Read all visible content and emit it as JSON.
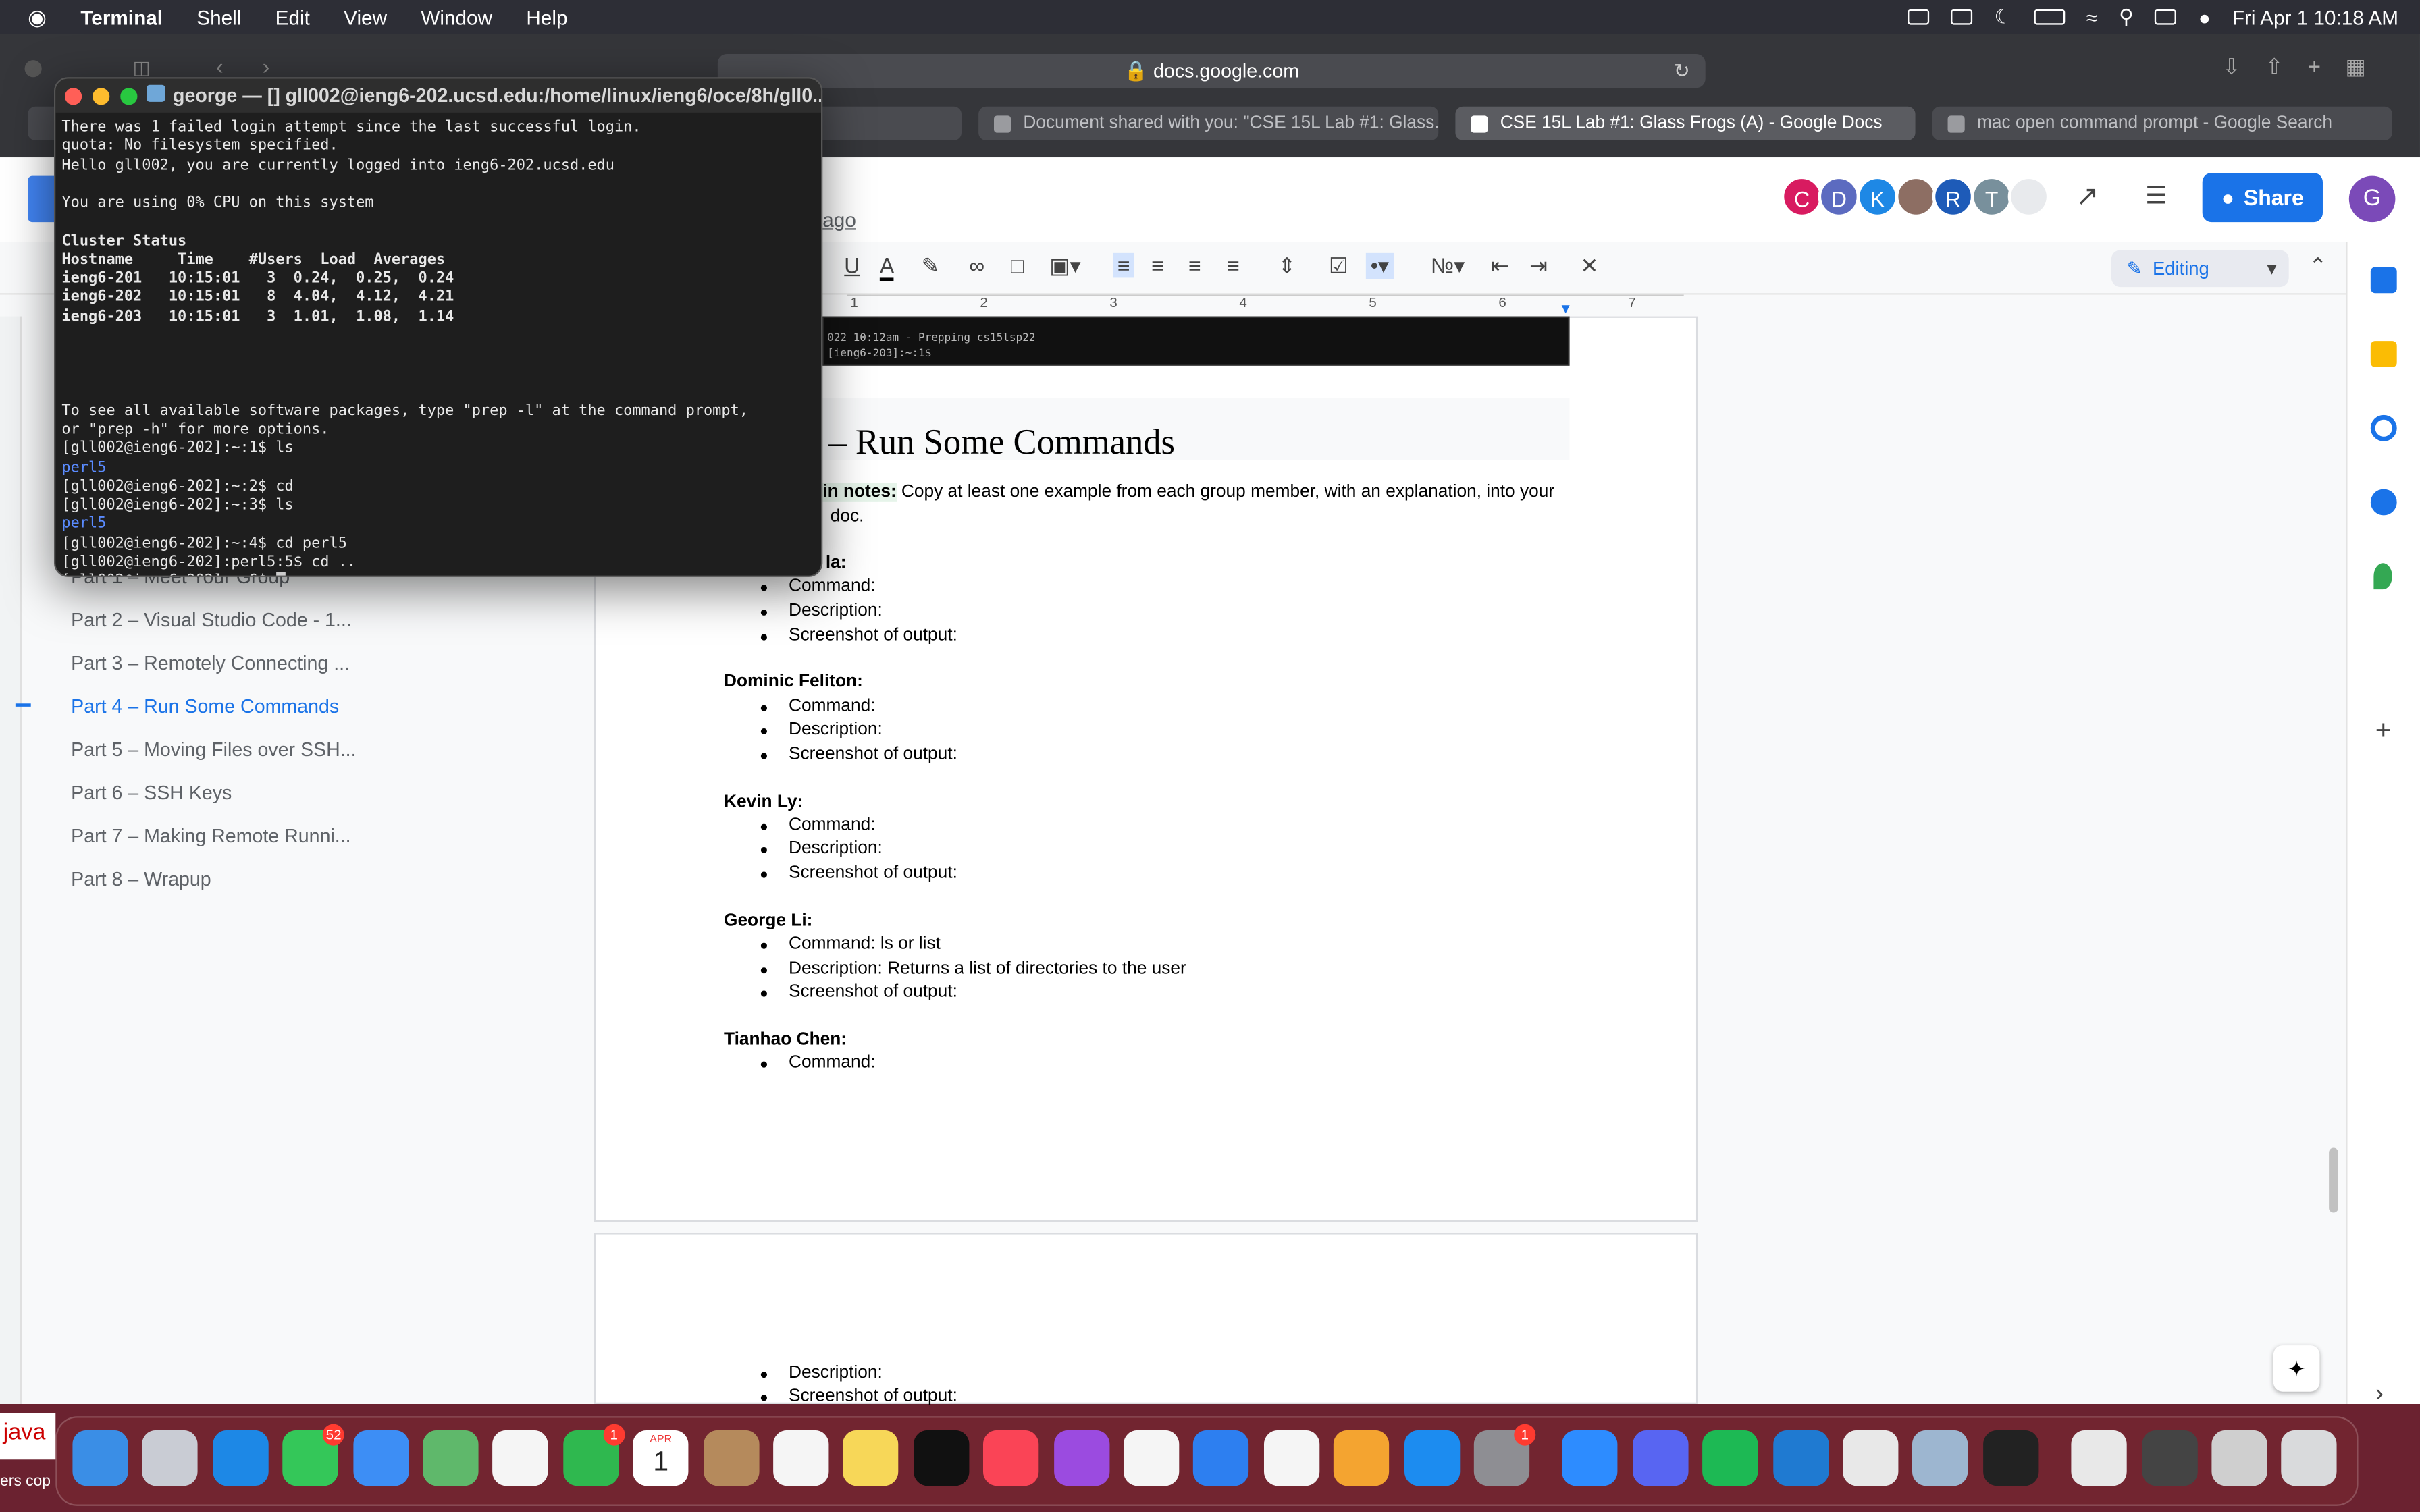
{
  "menubar": {
    "app": "Terminal",
    "items": [
      "Shell",
      "Edit",
      "View",
      "Window",
      "Help"
    ],
    "clock": "Fri Apr 1  10:18 AM"
  },
  "browser": {
    "url": "docs.google.com",
    "tabs": [
      {
        "label": "Document shared with you: \"CSE 15L Lab #1: Glass..."
      },
      {
        "label": "CSE 15L Lab #1: Glass Frogs (A) - Google Docs"
      },
      {
        "label": "mac open command prompt - Google Search"
      }
    ]
  },
  "docs": {
    "last_edit": "ago",
    "share_label": "Share",
    "editing_label": "Editing",
    "avatars": [
      {
        "letter": "C",
        "color": "#d81b60"
      },
      {
        "letter": "D",
        "color": "#5c6bc0"
      },
      {
        "letter": "K",
        "color": "#1e88e5"
      },
      {
        "letter": "",
        "color": "#8d6e63"
      },
      {
        "letter": "R",
        "color": "#1e5bb8"
      },
      {
        "letter": "T",
        "color": "#78909c"
      },
      {
        "letter": "",
        "color": "#e8eaed"
      }
    ],
    "user_avatar": "G",
    "ruler_marks": [
      "1",
      "2",
      "3",
      "4",
      "5",
      "6",
      "7"
    ],
    "outline": [
      {
        "label": "Part 1 – Meet Your Group"
      },
      {
        "label": "Part 2 – Visual Studio Code - 1..."
      },
      {
        "label": "Part 3 – Remotely Connecting ..."
      },
      {
        "label": "Part 4 – Run Some Commands"
      },
      {
        "label": "Part 5 – Moving Files over SSH..."
      },
      {
        "label": "Part 6 – SSH Keys"
      },
      {
        "label": "Part 7 – Making Remote Runni..."
      },
      {
        "label": "Part 8 – Wrapup"
      }
    ],
    "screenshot_strip": [
      "022 10:12am - Prepping cs15lsp22",
      "[ieng6-203]:~:1$"
    ],
    "heading": "– Run Some Commands",
    "note_label": "in notes:",
    "note_text": "Copy at least one example from each group member, with an explanation, into your",
    "note_text2": "doc.",
    "members": [
      {
        "name": "la:",
        "command": "Command:",
        "description": "Description:",
        "screenshot": "Screenshot of output:"
      },
      {
        "name": "Dominic Feliton:",
        "command": "Command:",
        "description": "Description:",
        "screenshot": "Screenshot of output:"
      },
      {
        "name": "Kevin Ly:",
        "command": "Command:",
        "description": "Description:",
        "screenshot": "Screenshot of output:"
      },
      {
        "name": "George Li:",
        "command": "Command: ls or list",
        "description": "Description: Returns a list of directories to the user",
        "screenshot": "Screenshot of output:"
      },
      {
        "name": "Tianhao Chen:",
        "command": "Command:"
      }
    ],
    "page2": {
      "description": "Description:",
      "screenshot": "Screenshot of output:"
    }
  },
  "terminal": {
    "title": "george — []  gll002@ieng6-202.ucsd.edu:/home/linux/ieng6/oce/8h/gll0...",
    "lines": [
      {
        "text": "There was 1 failed login attempt since the last successful login.",
        "style": ""
      },
      {
        "text": "quota: No filesystem specified.",
        "style": ""
      },
      {
        "text": "Hello gll002, you are currently logged into ieng6-202.ucsd.edu",
        "style": ""
      },
      {
        "text": "",
        "style": ""
      },
      {
        "text": "You are using 0% CPU on this system",
        "style": ""
      },
      {
        "text": "",
        "style": ""
      },
      {
        "text": "Cluster Status",
        "style": "b"
      },
      {
        "text": "Hostname     Time    #Users  Load  Averages",
        "style": "b"
      },
      {
        "text": "ieng6-201   10:15:01   3  0.24,  0.25,  0.24",
        "style": "b"
      },
      {
        "text": "ieng6-202   10:15:01   8  4.04,  4.12,  4.21",
        "style": "b"
      },
      {
        "text": "ieng6-203   10:15:01   3  1.01,  1.08,  1.14",
        "style": "b"
      },
      {
        "text": "",
        "style": ""
      },
      {
        "text": "",
        "style": ""
      },
      {
        "text": "",
        "style": ""
      },
      {
        "text": "",
        "style": ""
      },
      {
        "text": "To see all available software packages, type \"prep -l\" at the command prompt,",
        "style": ""
      },
      {
        "text": "or \"prep -h\" for more options.",
        "style": ""
      },
      {
        "text": "[gll002@ieng6-202]:~:1$ ls",
        "style": ""
      },
      {
        "text": "perl5",
        "style": "blue"
      },
      {
        "text": "[gll002@ieng6-202]:~:2$ cd",
        "style": ""
      },
      {
        "text": "[gll002@ieng6-202]:~:3$ ls",
        "style": ""
      },
      {
        "text": "perl5",
        "style": "blue"
      },
      {
        "text": "[gll002@ieng6-202]:~:4$ cd perl5",
        "style": ""
      },
      {
        "text": "[gll002@ieng6-202]:perl5:5$ cd ..",
        "style": ""
      },
      {
        "text": "[gll002@ieng6-202]:~:6$ ",
        "style": "cursor"
      }
    ]
  },
  "dock": {
    "left_label": "java",
    "left_sublabel": "ers cop",
    "calendar_month": "APR",
    "calendar_day": "1",
    "messages_badge": "52",
    "facetime_badge": "1",
    "settings_badge": "1",
    "apps": [
      {
        "name": "finder",
        "color": "#3a8ee6"
      },
      {
        "name": "launchpad",
        "color": "#c9ccd4"
      },
      {
        "name": "safari",
        "color": "#1d88e6"
      },
      {
        "name": "messages",
        "color": "#34c759"
      },
      {
        "name": "mail",
        "color": "#3d8ef5"
      },
      {
        "name": "maps",
        "color": "#5fb86b"
      },
      {
        "name": "photos",
        "color": "#f5f5f5"
      },
      {
        "name": "facetime",
        "color": "#2fb84f"
      },
      {
        "name": "calendar",
        "color": "#ffffff"
      },
      {
        "name": "contacts",
        "color": "#b58a5c"
      },
      {
        "name": "reminders",
        "color": "#f5f5f5"
      },
      {
        "name": "notes",
        "color": "#f7d758"
      },
      {
        "name": "tv",
        "color": "#111111"
      },
      {
        "name": "music",
        "color": "#fa4456"
      },
      {
        "name": "podcasts",
        "color": "#9b4be0"
      },
      {
        "name": "news",
        "color": "#f5f5f5"
      },
      {
        "name": "keynote",
        "color": "#2d7ff0"
      },
      {
        "name": "numbers",
        "color": "#f5f5f5"
      },
      {
        "name": "pages",
        "color": "#f4a430"
      },
      {
        "name": "app-store",
        "color": "#1c8cf0"
      },
      {
        "name": "system-preferences",
        "color": "#8e8e93"
      },
      {
        "name": "zoom",
        "color": "#2d8cff"
      },
      {
        "name": "discord",
        "color": "#5865f2"
      },
      {
        "name": "spotify",
        "color": "#1db954"
      },
      {
        "name": "vscode",
        "color": "#1f7ad1"
      },
      {
        "name": "script-editor",
        "color": "#e8e8e8"
      },
      {
        "name": "preview",
        "color": "#9db6d0"
      },
      {
        "name": "terminal",
        "color": "#222222"
      },
      {
        "name": "document",
        "color": "#e8e8e8"
      },
      {
        "name": "screenshot",
        "color": "#444444"
      },
      {
        "name": "downloads",
        "color": "#cfcfcf"
      },
      {
        "name": "trash",
        "color": "#d9dadc"
      }
    ]
  }
}
